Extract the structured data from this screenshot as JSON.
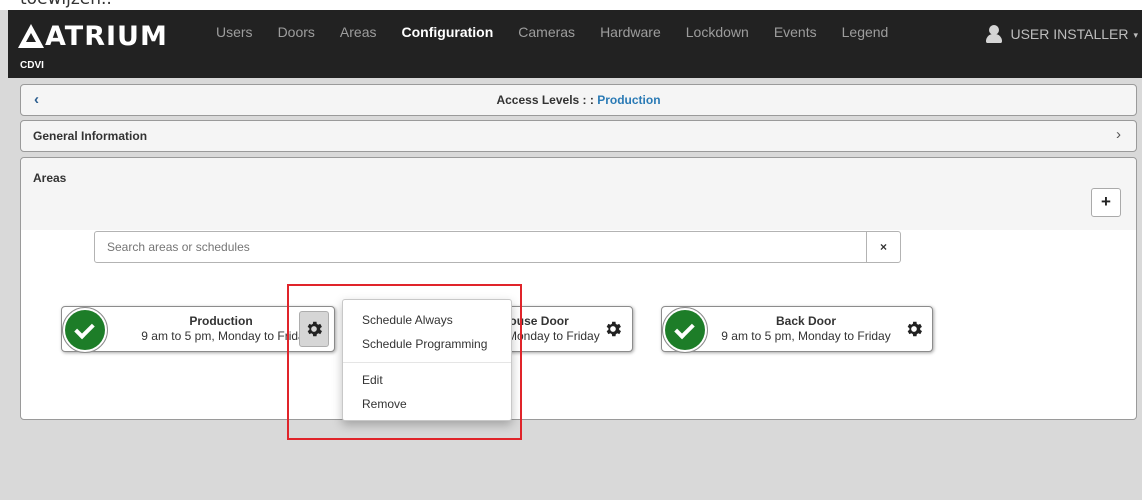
{
  "top_strip": {
    "text": "toewijzen.."
  },
  "navbar": {
    "brand": "ATRIUM",
    "brand_sub": "CDVI",
    "items": [
      {
        "label": "Users"
      },
      {
        "label": "Doors"
      },
      {
        "label": "Areas"
      },
      {
        "label": "Configuration",
        "active": true
      },
      {
        "label": "Cameras"
      },
      {
        "label": "Hardware"
      },
      {
        "label": "Lockdown"
      },
      {
        "label": "Events"
      },
      {
        "label": "Legend"
      }
    ],
    "user_label": "USER INSTALLER",
    "caret": "▾"
  },
  "access_panel": {
    "back": "‹",
    "title_prefix": "Access Levels : : ",
    "title_link": "Production"
  },
  "general_panel": {
    "title": "General Information",
    "chevron": "›"
  },
  "areas_panel": {
    "title": "Areas",
    "add_label": "+",
    "search": {
      "placeholder": "Search areas or schedules",
      "value": "",
      "clear": "×"
    },
    "cards": [
      {
        "name": "Production",
        "schedule": "9 am to 5 pm, Monday to Friday"
      },
      {
        "name": "Warehouse Door",
        "schedule": "9 am to 5 pm, Monday to Friday"
      },
      {
        "name": "Back Door",
        "schedule": "9 am to 5 pm, Monday to Friday"
      }
    ]
  },
  "context_menu": {
    "items": [
      "Schedule Always",
      "Schedule Programming"
    ],
    "items2": [
      "Edit",
      "Remove"
    ]
  },
  "colors": {
    "navbar": "#222222",
    "active_check": "#1d7d28",
    "link": "#2a7ab5",
    "highlight": "#e0242a"
  }
}
